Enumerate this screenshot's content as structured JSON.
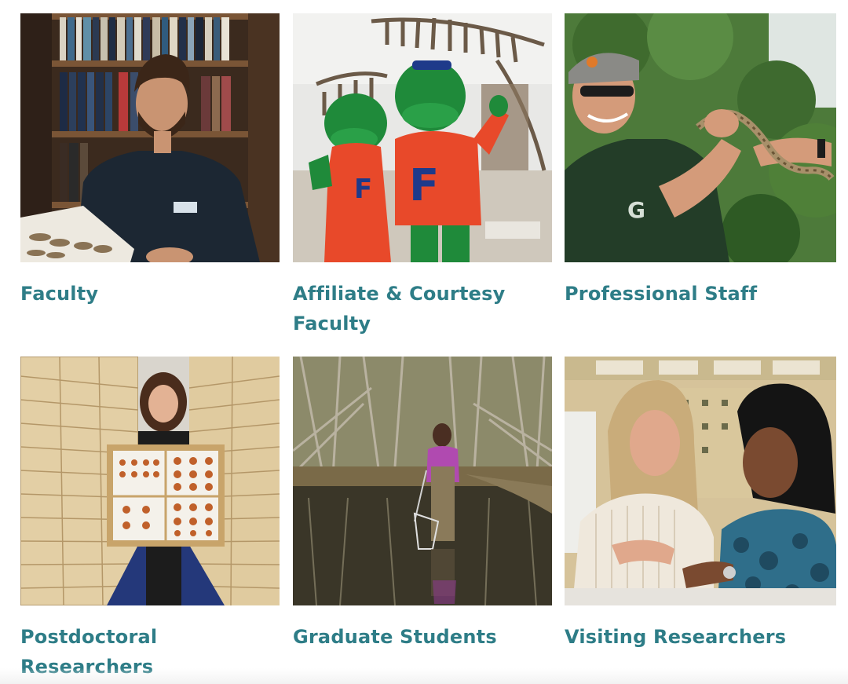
{
  "cards": [
    {
      "label": "Faculty",
      "image_alt": "Faculty member seated in front of library bookshelves with specimen tray",
      "icon": "faculty-photo"
    },
    {
      "label": "Affiliate & Courtesy Faculty",
      "image_alt": "Two alligator mascots in orange F jerseys in front of dinosaur skeleton",
      "icon": "affiliate-photo"
    },
    {
      "label": "Professional Staff",
      "image_alt": "Staff member in cap holding a snake outdoors",
      "icon": "staff-photo"
    },
    {
      "label": "Postdoctoral Researchers",
      "image_alt": "Researcher holding butterfly display case between specimen cabinets",
      "icon": "postdoc-photo"
    },
    {
      "label": "Graduate Students",
      "image_alt": "Student with net wading in a forest creek",
      "icon": "grad-photo"
    },
    {
      "label": "Visiting Researchers",
      "image_alt": "Two researchers examining specimens at a lab bench",
      "icon": "visiting-photo"
    }
  ],
  "colors": {
    "link": "#2e7d87",
    "background": "#ffffff"
  }
}
